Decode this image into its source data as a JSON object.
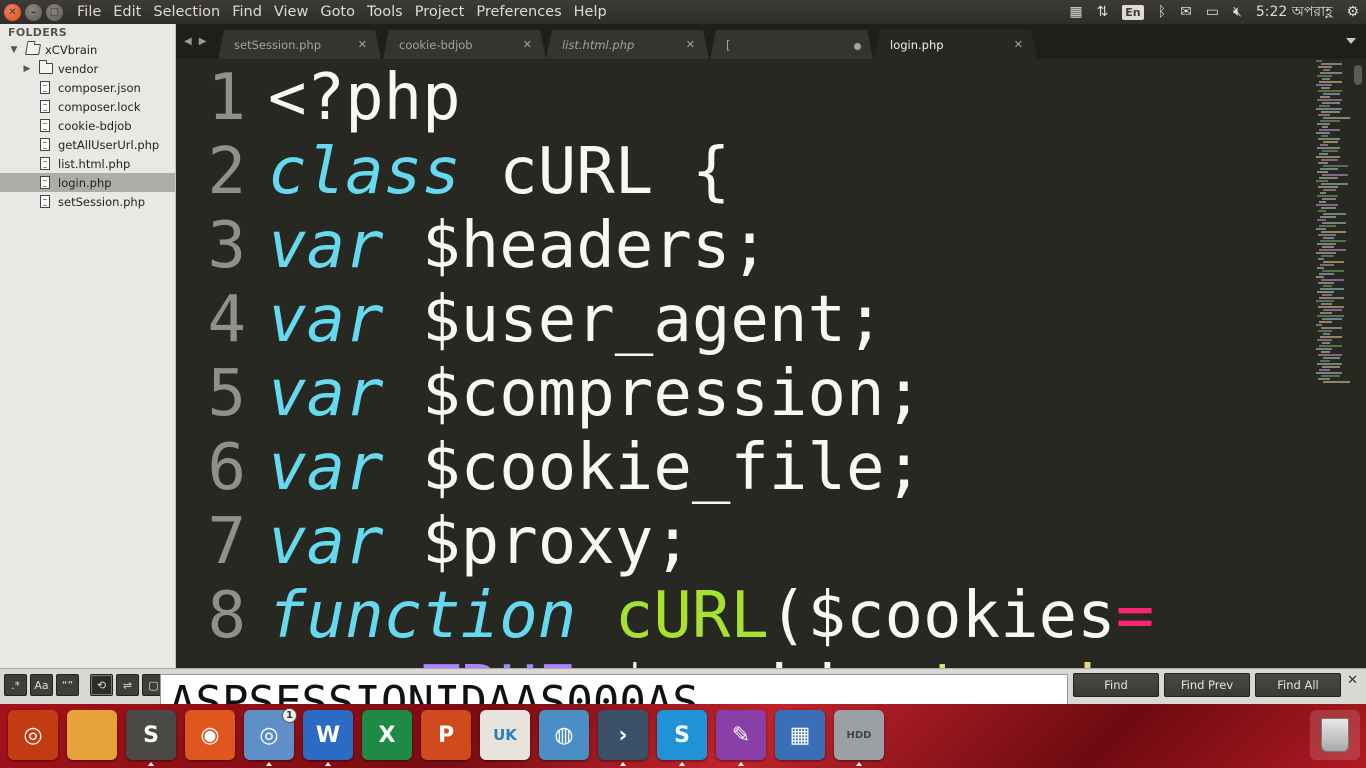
{
  "menubar": {
    "menus": [
      "File",
      "Edit",
      "Selection",
      "Find",
      "View",
      "Goto",
      "Tools",
      "Project",
      "Preferences",
      "Help"
    ],
    "keyboard_layout": "En",
    "clock": "5:22 অপরাহ্ণ"
  },
  "sidebar": {
    "title": "FOLDERS",
    "root": "xCVbrain",
    "items": [
      {
        "type": "folder",
        "label": "vendor"
      },
      {
        "type": "file",
        "label": "composer.json"
      },
      {
        "type": "file",
        "label": "composer.lock"
      },
      {
        "type": "file",
        "label": "cookie-bdjob"
      },
      {
        "type": "file",
        "label": "getAllUserUrl.php"
      },
      {
        "type": "file",
        "label": "list.html.php"
      },
      {
        "type": "file",
        "label": "login.php",
        "selected": true
      },
      {
        "type": "file",
        "label": "setSession.php"
      }
    ]
  },
  "tabs": [
    {
      "label": "setSession.php",
      "active": false,
      "italic": false,
      "dirty": false
    },
    {
      "label": "cookie-bdjob",
      "active": false,
      "italic": false,
      "dirty": false
    },
    {
      "label": "list.html.php",
      "active": false,
      "italic": true,
      "dirty": false
    },
    {
      "label": "[",
      "active": false,
      "italic": false,
      "dirty": true
    },
    {
      "label": "login.php",
      "active": true,
      "italic": false,
      "dirty": false
    }
  ],
  "editor": {
    "lines": [
      {
        "n": "1",
        "tokens": [
          {
            "t": "<?php",
            "c": "pl"
          }
        ]
      },
      {
        "n": "2",
        "tokens": [
          {
            "t": "class",
            "c": "kw"
          },
          {
            "t": " cURL {",
            "c": "pl"
          }
        ]
      },
      {
        "n": "3",
        "tokens": [
          {
            "t": "var",
            "c": "kw"
          },
          {
            "t": " $headers;",
            "c": "pl"
          }
        ]
      },
      {
        "n": "4",
        "tokens": [
          {
            "t": "var",
            "c": "kw"
          },
          {
            "t": " $user_agent;",
            "c": "pl"
          }
        ]
      },
      {
        "n": "5",
        "tokens": [
          {
            "t": "var",
            "c": "kw"
          },
          {
            "t": " $compression;",
            "c": "pl"
          }
        ]
      },
      {
        "n": "6",
        "tokens": [
          {
            "t": "var",
            "c": "kw"
          },
          {
            "t": " $cookie_file;",
            "c": "pl"
          }
        ]
      },
      {
        "n": "7",
        "tokens": [
          {
            "t": "var",
            "c": "kw"
          },
          {
            "t": " $proxy;",
            "c": "pl"
          }
        ]
      },
      {
        "n": "8",
        "tokens": [
          {
            "t": "function",
            "c": "kw"
          },
          {
            "t": " ",
            "c": "pl"
          },
          {
            "t": "cURL",
            "c": "fn"
          },
          {
            "t": "($cookies",
            "c": "pl"
          },
          {
            "t": "=",
            "c": "op"
          }
        ]
      },
      {
        "n": "",
        "tokens": [
          {
            "t": "    ",
            "c": "pl"
          },
          {
            "t": "TRUE",
            "c": "cst"
          },
          {
            "t": ",$cookie=",
            "c": "pl"
          },
          {
            "t": "'cook",
            "c": "str"
          }
        ]
      }
    ]
  },
  "find": {
    "options": [
      "regex",
      "case",
      "word",
      "wrap",
      "in-selection",
      "highlight"
    ],
    "query": "ASPSESSIONIDAAS000AS",
    "find_label": "Find",
    "find_prev_label": "Find Prev",
    "find_all_label": "Find All"
  },
  "dock": {
    "items": [
      {
        "name": "dash-icon",
        "bg": "#c23b12",
        "glyph": "◎",
        "running": false
      },
      {
        "name": "files-icon",
        "bg": "#e8a23a",
        "glyph": "",
        "running": false
      },
      {
        "name": "sublime-text-icon",
        "bg": "#4a4945",
        "glyph": "S",
        "running": true
      },
      {
        "name": "firefox-icon",
        "bg": "#e0561f",
        "glyph": "◉",
        "running": false
      },
      {
        "name": "chromium-icon",
        "bg": "#5f8fc9",
        "glyph": "◎",
        "running": true,
        "badge": "1"
      },
      {
        "name": "word-icon",
        "bg": "#2b6bc4",
        "glyph": "W",
        "running": true
      },
      {
        "name": "excel-icon",
        "bg": "#1f8a45",
        "glyph": "X",
        "running": false
      },
      {
        "name": "powerpoint-icon",
        "bg": "#d04a1f",
        "glyph": "P",
        "running": false
      },
      {
        "name": "ubuntu-software-icon",
        "bg": "#e7e4de",
        "glyph": "UK",
        "running": false
      },
      {
        "name": "remmina-icon",
        "bg": "#4a8ec4",
        "glyph": "◍",
        "running": false
      },
      {
        "name": "terminal-icon",
        "bg": "#3b5168",
        "glyph": "›",
        "running": true
      },
      {
        "name": "skype-icon",
        "bg": "#1f93d6",
        "glyph": "S",
        "running": true
      },
      {
        "name": "editor-icon",
        "bg": "#8a3fa8",
        "glyph": "✎",
        "running": true
      },
      {
        "name": "workspace-switcher-icon",
        "bg": "#3a6fb8",
        "glyph": "▦",
        "running": false
      },
      {
        "name": "hdd-icon",
        "bg": "#9aa0a4",
        "glyph": "HDD",
        "running": true
      }
    ],
    "trash": "trash-icon"
  }
}
